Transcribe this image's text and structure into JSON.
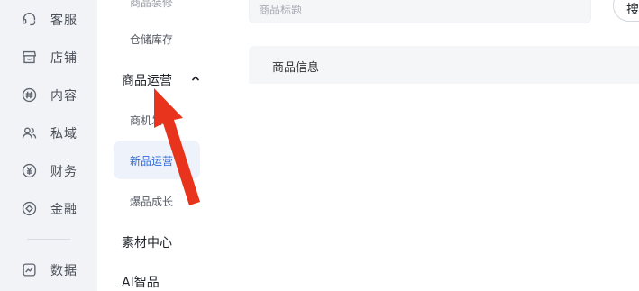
{
  "rail": {
    "items": [
      {
        "label": "客服",
        "icon": "headset-icon"
      },
      {
        "label": "店铺",
        "icon": "store-icon"
      },
      {
        "label": "内容",
        "icon": "hashtag-icon"
      },
      {
        "label": "私域",
        "icon": "users-icon"
      },
      {
        "label": "财务",
        "icon": "yen-icon"
      },
      {
        "label": "金融",
        "icon": "finance-icon"
      },
      {
        "label": "数据",
        "icon": "chart-icon"
      }
    ]
  },
  "subnav": {
    "partial_label": "商品装修",
    "inventory_label": "仓储库存",
    "group_operations": "商品运营",
    "opportunity_label": "商机发现",
    "new_product_label": "新品运营",
    "hot_growth_label": "爆品成长",
    "group_materials": "素材中心",
    "group_ai": "AI智品"
  },
  "main": {
    "search_placeholder": "商品标题",
    "search_button_label": "搜",
    "info_header": "商品信息"
  },
  "colors": {
    "rail_bg": "#f1f3f6",
    "active_bg": "#eef2fb",
    "active_text": "#2f6bd8",
    "arrow": "#e8341c"
  }
}
